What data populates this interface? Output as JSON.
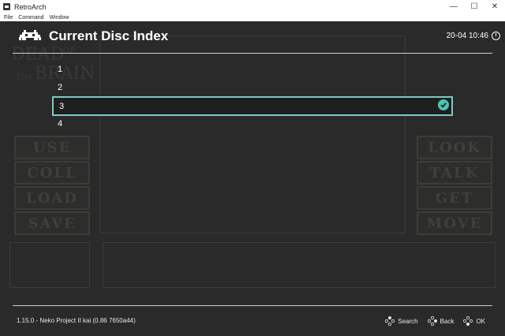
{
  "window": {
    "title": "RetroArch",
    "controls": {
      "minimize": "—",
      "maximize": "☐",
      "close": "✕"
    }
  },
  "menubar": [
    "File",
    "Command",
    "Window"
  ],
  "background_art": {
    "title_line1": "DEAD",
    "title_of": "OF",
    "title_the": "THE",
    "title_line2": "BRAIN",
    "buttons_left": [
      "USE",
      "COLL",
      "LOAD",
      "SAVE"
    ],
    "buttons_right": [
      "LOOK",
      "TALK",
      "GET",
      "MOVE"
    ]
  },
  "menu": {
    "title": "Current Disc Index",
    "clock": "20-04 10:46",
    "items": [
      "1",
      "2",
      "3",
      "4"
    ],
    "selected_index": 2
  },
  "footer": {
    "version": "1.15.0 - Neko Project II kai (0.86  7650a44)",
    "actions": [
      "Search",
      "Back",
      "OK"
    ]
  },
  "colors": {
    "background": "#2a2a2a",
    "accent": "#7cc9c2",
    "check": "#4fc3b2",
    "text": "#ffffff"
  }
}
